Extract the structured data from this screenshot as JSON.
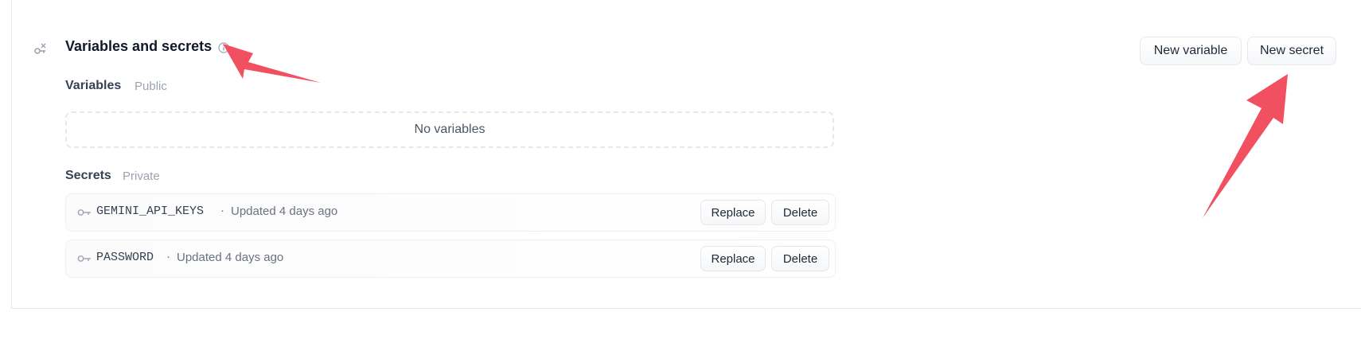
{
  "section": {
    "title": "Variables and secrets",
    "icon": "key-lock-icon",
    "info_icon": "info-icon"
  },
  "header_actions": {
    "new_variable_label": "New variable",
    "new_secret_label": "New secret"
  },
  "variables": {
    "heading": "Variables",
    "visibility": "Public",
    "empty_text": "No variables"
  },
  "secrets": {
    "heading": "Secrets",
    "visibility": "Private",
    "items": [
      {
        "name": "GEMINI_API_KEYS",
        "separator": "·",
        "updated": "Updated 4 days ago",
        "replace_label": "Replace",
        "delete_label": "Delete"
      },
      {
        "name": "PASSWORD",
        "separator": "·",
        "updated": "Updated 4 days ago",
        "replace_label": "Replace",
        "delete_label": "Delete"
      }
    ]
  },
  "colors": {
    "annotation_arrow": "#f0505f",
    "border": "#e5e7eb",
    "muted_text": "#9ca3af"
  }
}
